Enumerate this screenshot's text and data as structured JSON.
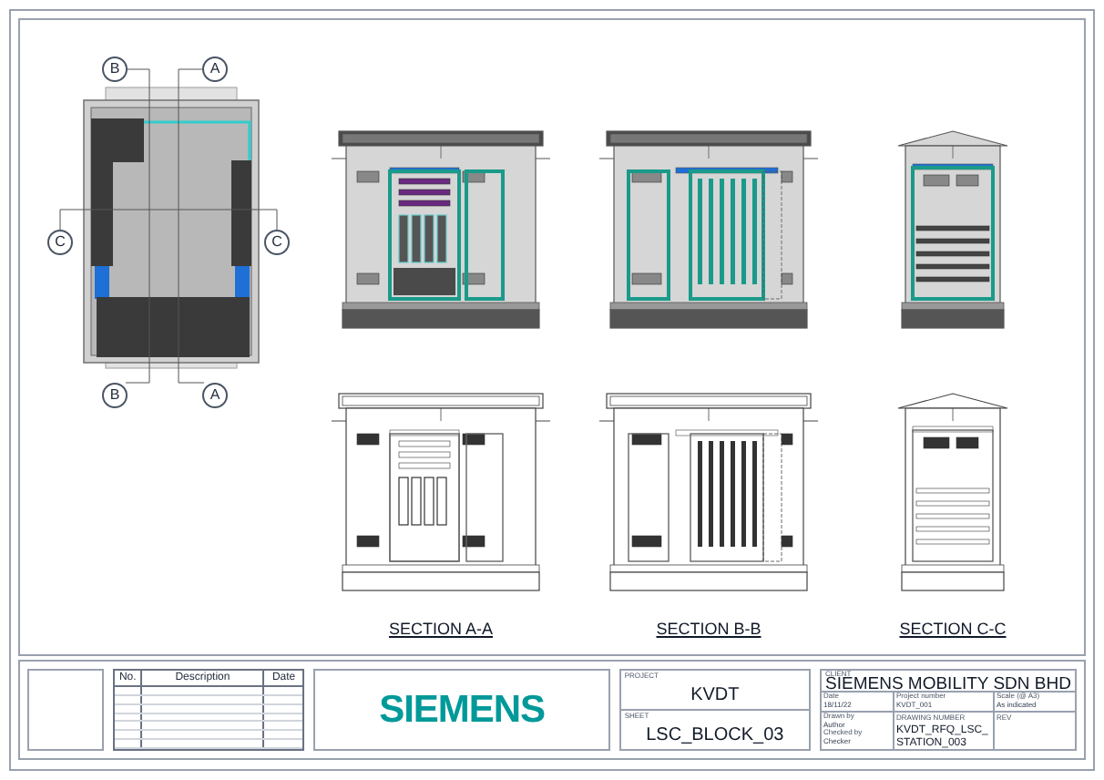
{
  "plan_view": {
    "section_markers": [
      {
        "label": "B"
      },
      {
        "label": "A"
      },
      {
        "label": "C"
      },
      {
        "label": "C"
      },
      {
        "label": "B"
      },
      {
        "label": "A"
      }
    ]
  },
  "sections": [
    {
      "label": "SECTION A-A"
    },
    {
      "label": "SECTION B-B"
    },
    {
      "label": "SECTION C-C"
    }
  ],
  "revision_table": {
    "columns": [
      "No.",
      "Description",
      "Date"
    ]
  },
  "title_block": {
    "logo": "SIEMENS",
    "project_caption": "PROJECT",
    "project": "KVDT",
    "sheet_caption": "SHEET",
    "sheet": "LSC_BLOCK_03",
    "client_caption": "CLIENT",
    "client": "SIEMENS MOBILITY SDN BHD",
    "date_caption": "Date",
    "date": "18/11/22",
    "project_number_caption": "Project number",
    "project_number": "KVDT_001",
    "scale_caption": "Scale (@ A3)",
    "scale": "As indicated",
    "drawn_by_caption": "Drawn by",
    "drawn_by": "Author",
    "checked_by_caption": "Checked by",
    "checked_by": "Checker",
    "drawing_number_caption": "DRAWING NUMBER",
    "drawing_number": "KVDT_RFQ_LSC_STATION_003",
    "rev_caption": "REV"
  }
}
